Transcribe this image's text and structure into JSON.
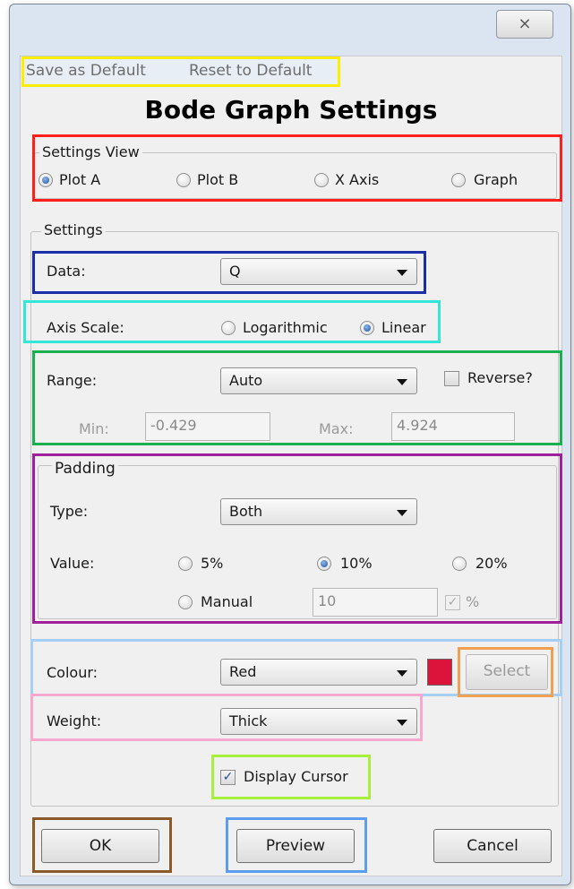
{
  "window": {
    "close_glyph": "⨯"
  },
  "menu": {
    "save_default": "Save as Default",
    "reset_default": "Reset to Default"
  },
  "title": "Bode Graph Settings",
  "settings_view": {
    "label": "Settings View",
    "options": [
      "Plot A",
      "Plot B",
      "X Axis",
      "Graph"
    ],
    "selected": "Plot A"
  },
  "settings": {
    "label": "Settings",
    "data": {
      "label": "Data:",
      "value": "Q"
    },
    "axis_scale": {
      "label": "Axis Scale:",
      "options": [
        "Logarithmic",
        "Linear"
      ],
      "selected": "Linear"
    },
    "range": {
      "label": "Range:",
      "value": "Auto",
      "reverse_label": "Reverse?",
      "reverse_checked": false,
      "min_label": "Min:",
      "min_value": "-0.429",
      "max_label": "Max:",
      "max_value": "4.924"
    },
    "padding": {
      "label": "Padding",
      "type_label": "Type:",
      "type_value": "Both",
      "value_label": "Value:",
      "options": [
        "5%",
        "10%",
        "20%",
        "Manual"
      ],
      "selected": "10%",
      "manual_value": "10",
      "percent_label": "%",
      "percent_checked": true
    },
    "colour": {
      "label": "Colour:",
      "value": "Red",
      "swatch": "#dc143c",
      "select_label": "Select"
    },
    "weight": {
      "label": "Weight:",
      "value": "Thick"
    },
    "display_cursor": {
      "label": "Display Cursor",
      "checked": true
    }
  },
  "buttons": {
    "ok": "OK",
    "preview": "Preview",
    "cancel": "Cancel"
  },
  "highlight_colors": {
    "menu": "#ffee00",
    "settings_view": "#ff1f1f",
    "data": "#1a2ea8",
    "axis_scale": "#35e6d8",
    "range": "#1ab050",
    "padding": "#a0209a",
    "colour": "#a6cff6",
    "select": "#f0a050",
    "weight": "#f7a8cf",
    "display_cursor": "#a6ef3c",
    "ok": "#8a5a2a",
    "preview": "#5d9df0"
  }
}
